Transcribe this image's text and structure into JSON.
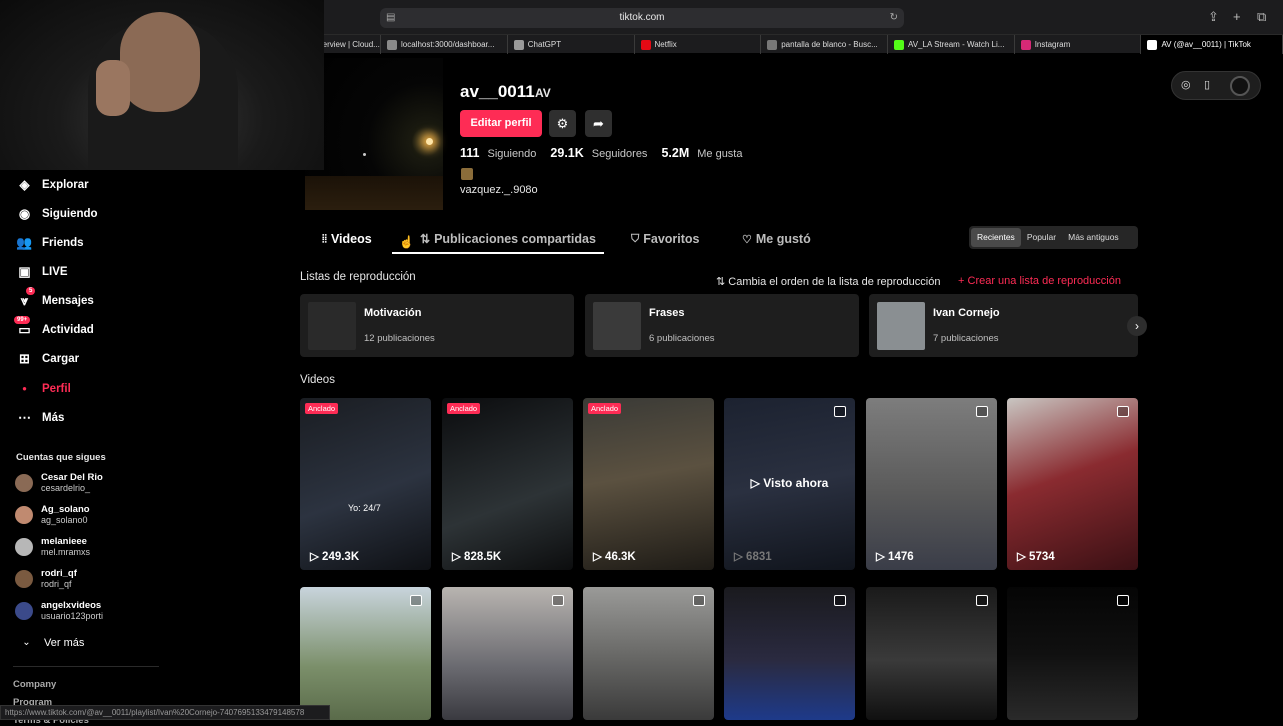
{
  "browser": {
    "url": "tiktok.com",
    "status_url": "https://www.tiktok.com/@av__0011/playlist/Ivan%20Cornejo-7407695133479148578",
    "tabs": [
      {
        "label": "erview | Cloud...",
        "fav_color": "#4a90e2"
      },
      {
        "label": "localhost:3000/dashboar...",
        "fav_color": "#8a8a8a"
      },
      {
        "label": "ChatGPT",
        "fav_color": "#9a9a9a"
      },
      {
        "label": "Netflix",
        "fav_color": "#e50914"
      },
      {
        "label": "pantalla de blanco - Busc...",
        "fav_color": "#777777"
      },
      {
        "label": "AV_LA Stream - Watch Li...",
        "fav_color": "#53fc18"
      },
      {
        "label": "Instagram",
        "fav_color": "#d62976"
      },
      {
        "label": "AV (@av__0011) | TikTok",
        "fav_color": "#ffffff"
      }
    ]
  },
  "sidebar": {
    "nav": [
      {
        "label": "Explorar",
        "icon": "compass-icon"
      },
      {
        "label": "Siguiendo",
        "icon": "following-icon"
      },
      {
        "label": "Friends",
        "icon": "friends-icon"
      },
      {
        "label": "LIVE",
        "icon": "live-icon"
      },
      {
        "label": "Mensajes",
        "icon": "messages-icon",
        "badge": "5"
      },
      {
        "label": "Actividad",
        "icon": "activity-icon",
        "badge": "99+"
      },
      {
        "label": "Cargar",
        "icon": "upload-icon"
      },
      {
        "label": "Perfil",
        "icon": "profile-icon"
      },
      {
        "label": "Más",
        "icon": "more-icon"
      }
    ],
    "following_title": "Cuentas que sigues",
    "accounts": [
      {
        "name": "Cesar Del Rio",
        "handle": "cesardelrio_",
        "color": "#8a6a55"
      },
      {
        "name": "Ag_solano",
        "handle": "ag_solano0",
        "color": "#c08a70"
      },
      {
        "name": "melanieee",
        "handle": "mel.mramxs",
        "color": "#b7b7b7"
      },
      {
        "name": "rodri_qf",
        "handle": "rodri_qf",
        "color": "#7a5a40"
      },
      {
        "name": "angelxvideos",
        "handle": "usuario123porti",
        "color": "#3b4a8a"
      }
    ],
    "see_more": "Ver más",
    "footer": [
      "Company",
      "Program",
      "Terms & Policies"
    ]
  },
  "profile": {
    "username": "av__0011",
    "nickname": "AV",
    "edit_label": "Editar perfil",
    "following_count": "111",
    "following_label": "Siguiendo",
    "followers_count": "29.1K",
    "followers_label": "Seguidores",
    "likes_count": "5.2M",
    "likes_label": "Me gusta",
    "bio": "vazquez._.908o"
  },
  "tabs": {
    "videos": "Videos",
    "reposts": "Publicaciones compartidas",
    "favorites": "Favoritos",
    "liked": "Me gustó"
  },
  "sort": [
    "Recientes",
    "Popular",
    "Más antiguos"
  ],
  "playlists": {
    "title": "Listas de reproducción",
    "reorder": "Cambia el orden de la lista de reproducción",
    "create": "Crear una lista de reproducción",
    "items": [
      {
        "name": "Motivación",
        "count": "12 publicaciones",
        "thumb": "#2a2a2a"
      },
      {
        "name": "Frases",
        "count": "6 publicaciones",
        "thumb": "#3a3a3a"
      },
      {
        "name": "Ivan Cornejo",
        "count": "7 publicaciones",
        "thumb": "#8a8f92"
      }
    ]
  },
  "videos": {
    "title": "Videos",
    "pinned_label": "Anclado",
    "watched_label": "Visto ahora",
    "row1": [
      {
        "views": "249.3K",
        "pinned": true,
        "caption": "Yo: 24/7",
        "bg": "linear-gradient(160deg,#1a1d22,#2c3340 55%,#0e1014)"
      },
      {
        "views": "828.5K",
        "pinned": true,
        "bg": "linear-gradient(160deg,#0b0c0e,#2d3336 60%,#0c0d0e)"
      },
      {
        "views": "46.3K",
        "pinned": true,
        "bg": "linear-gradient(170deg,#3a3a36,#5b5140 45%,#1e1b16)"
      },
      {
        "views": "6831",
        "watched": true,
        "bg": "linear-gradient(170deg,#1c2230,#2a3040 50%,#10141c)"
      },
      {
        "views": "1476",
        "bg": "linear-gradient(180deg,#7d7d7d,#5a5a5a 55%,#3a3d48)"
      },
      {
        "views": "5734",
        "bg": "linear-gradient(160deg,#c9c6c2,#8a2b30 45%,#3a1014)"
      }
    ],
    "row2": [
      {
        "bg": "linear-gradient(180deg,#c8d4dc,#7b8f6a 60%,#5a6b4a)"
      },
      {
        "bg": "linear-gradient(180deg,#b8b4b0,#6a6a70 60%,#3a3a40)"
      },
      {
        "bg": "linear-gradient(180deg,#9a9a98,#6a6a68 50%,#3a3a3a)"
      },
      {
        "bg": "linear-gradient(180deg,#1a1a1e,#2a2a40 55%,#1e3a8a)"
      },
      {
        "bg": "linear-gradient(180deg,#1a1a1a,#3a3a3a 55%,#101010)"
      },
      {
        "bg": "linear-gradient(180deg,#050505,#101010 50%,#2a2a2a)"
      }
    ]
  }
}
